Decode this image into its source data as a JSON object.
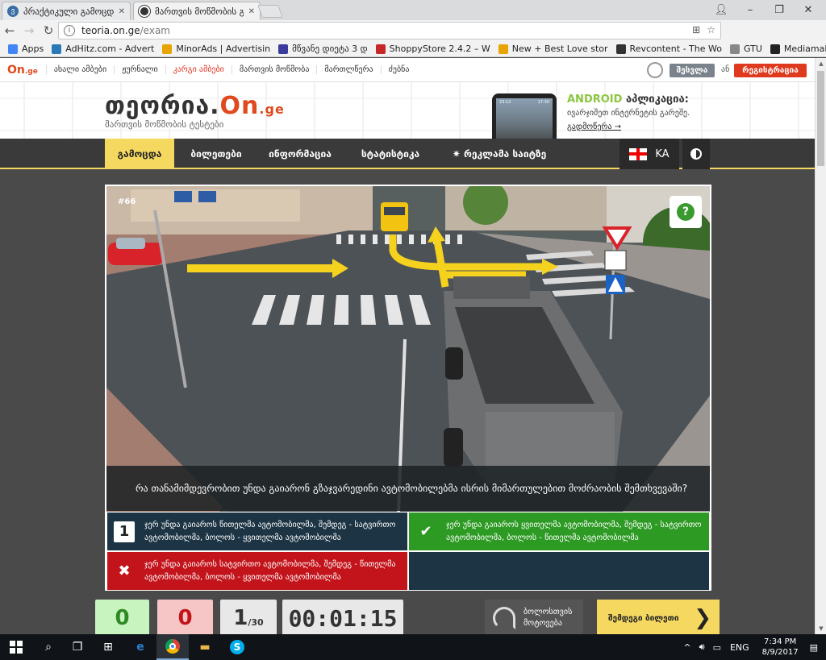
{
  "browser": {
    "tabs": [
      {
        "title": "პრაქტიკული გამოცდა",
        "icon_color": "#3a6ea5",
        "active": false
      },
      {
        "title": "მართვის მოწმობის გ",
        "icon_color": "#333333",
        "active": true
      }
    ],
    "url_host": "teoria.on.ge",
    "url_path": "/exam",
    "bookmarks": [
      {
        "label": "Apps",
        "icon": "apps-icon",
        "color": "#4285f4"
      },
      {
        "label": "AdHitz.com - Advert",
        "icon": "adhitz-icon",
        "color": "#2a7ab8"
      },
      {
        "label": "MinorAds | Advertisin",
        "icon": "minorads-icon",
        "color": "#e8a400"
      },
      {
        "label": "მწვანე დიეტა 3 დ",
        "icon": "play-icon",
        "color": "#3b3b9e"
      },
      {
        "label": "ShoppyStore 2.4.2 – W",
        "icon": "shoppy-icon",
        "color": "#c62828"
      },
      {
        "label": "New + Best Love stor",
        "icon": "love-icon",
        "color": "#e8a400"
      },
      {
        "label": "Revcontent - The Wo",
        "icon": "revcontent-icon",
        "color": "#333333"
      },
      {
        "label": "GTU",
        "icon": "page-icon",
        "color": "#888888"
      },
      {
        "label": "Mediamall.GE",
        "icon": "mediamall-icon",
        "color": "#222222"
      }
    ],
    "overflow_label": "»"
  },
  "site": {
    "logo_small": "On",
    "logo_small_suffix": ".ge",
    "nav": [
      {
        "label": "ახალი ამბები",
        "red": false
      },
      {
        "label": "ჟურნალი",
        "red": false
      },
      {
        "label": "კარგი ამბები",
        "red": true
      },
      {
        "label": "მართვის მოწმობა",
        "red": false
      },
      {
        "label": "მართლწერა",
        "red": false
      },
      {
        "label": "ძებნა",
        "red": false
      }
    ],
    "login_label": "შესვლა",
    "or_label": "ან",
    "register_label": "რეგისტრაცია",
    "brand_prefix": "თეორია.",
    "brand_on": "On",
    "brand_suffix": ".ge",
    "tagline": "მართვის მოწმობის ტესტები",
    "promo_title_green": "ANDROID",
    "promo_title": " აპლიკაცია:",
    "promo_sub": "ივარჯიშეთ ინტერნეტის გარეშე.",
    "promo_more": "გადმოწერა →",
    "phone_time_left": "23:12",
    "phone_time_center": "17:30"
  },
  "menu": {
    "items": [
      {
        "label": "გამოცდა",
        "active": true
      },
      {
        "label": "ბილეთები",
        "active": false
      },
      {
        "label": "ინფორმაცია",
        "active": false
      },
      {
        "label": "სტატისტიკა",
        "active": false
      },
      {
        "label": "✷ რეკლამა საიტზე",
        "active": false
      }
    ],
    "lang": "KA"
  },
  "exam": {
    "question_number": "#66",
    "help_label": "?",
    "question": "რა თანამიმდევრობით უნდა გაიარონ გზაჯვარედინი ავტომობილებმა ისრის მიმართულებით მოძრაობის შემთხვევაში?",
    "answers": [
      {
        "mark": "1",
        "state": "dark",
        "line1": "ჯერ უნდა გაიაროს წითელმა ავტომობილმა, შემდეგ - სატვირთო",
        "line2": "ავტომობილმა, ბოლოს - ყვითელმა ავტომობილმა"
      },
      {
        "mark": "✔",
        "state": "green",
        "line1": "ჯერ უნდა გაიაროს ყვითელმა ავტომობილმა, შემდეგ - სატვირთო",
        "line2": "ავტომობილმა, ბოლოს - წითელმა ავტომობილმა"
      },
      {
        "mark": "✖",
        "state": "red",
        "line1": "ჯერ უნდა გაიაროს სატვირთო ავტომობილმა, შემდეგ - წითელმა",
        "line2": "ავტომობილმა, ბოლოს - ყვითელმა ავტომობილმა"
      }
    ]
  },
  "stats": {
    "correct": "0",
    "wrong": "0",
    "current": "1",
    "total": "/30",
    "timer": "00:01:15",
    "skip_line1": "ბოლოსთვის",
    "skip_line2": "მოტოვება",
    "next_label": "შემდეგი ბილეთი",
    "next_chevron": "❯"
  },
  "taskbar": {
    "lang": "ENG",
    "time": "7:34 PM",
    "date": "8/9/2017"
  }
}
